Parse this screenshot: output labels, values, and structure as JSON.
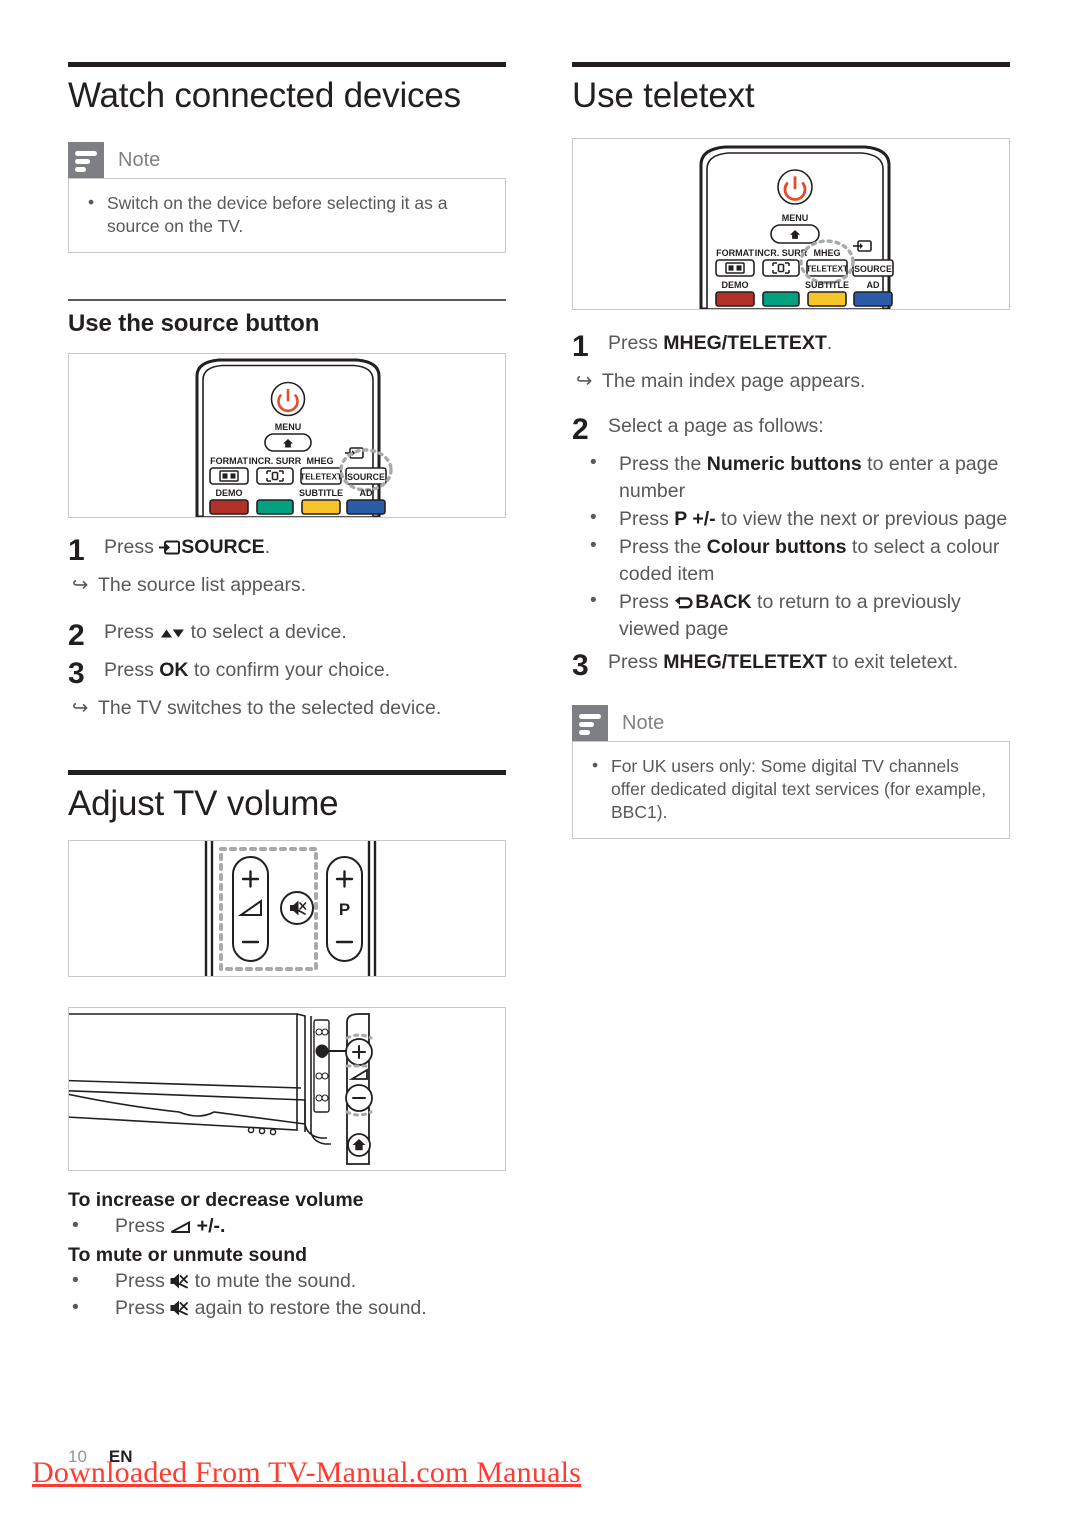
{
  "left_column": {
    "section_title": "Watch connected devices",
    "note": {
      "label": "Note",
      "items": [
        "Switch on the device before selecting it as a source on the TV."
      ]
    },
    "sub_title": "Use the source button",
    "figure_caption": "remote-control-top-source",
    "steps": [
      {
        "num": "1",
        "pre": "Press ",
        "icon": "source-icon",
        "bold": "SOURCE",
        "post": ".",
        "result": "The source list appears."
      },
      {
        "num": "2",
        "pre": "Press ",
        "icon": "updown-arrows",
        "bold": "",
        "post": " to select a device.",
        "result": ""
      },
      {
        "num": "3",
        "pre": "Press ",
        "icon": "",
        "bold": "OK",
        "post": " to confirm your choice.",
        "result": "The TV switches to the selected device."
      }
    ],
    "volume_section_title": "Adjust TV volume",
    "volume_block_1": {
      "title": "To increase or decrease volume",
      "items": [
        {
          "pre": "Press ",
          "icon": "volume-icon",
          "post": " +/-."
        }
      ]
    },
    "volume_block_2": {
      "title": "To mute or unmute sound",
      "items": [
        {
          "pre": "Press ",
          "icon": "mute-icon",
          "post": " to mute the sound."
        },
        {
          "pre": "Press ",
          "icon": "mute-icon",
          "post": " again to restore the sound."
        }
      ]
    }
  },
  "right_column": {
    "section_title": "Use teletext",
    "figure_caption": "remote-control-top-teletext",
    "step1": {
      "num": "1",
      "pre": "Press ",
      "bold": "MHEG/TELETEXT",
      "post": ".",
      "result": "The main index page appears."
    },
    "step2": {
      "num": "2",
      "text": "Select a page as follows:",
      "bullets": [
        {
          "pre": "Press the ",
          "bold": "Numeric buttons",
          "post": " to enter a page number",
          "icon": ""
        },
        {
          "pre": "Press ",
          "bold": "P +/-",
          "post": " to view the next or previous page",
          "icon": ""
        },
        {
          "pre": "Press the ",
          "bold": "Colour buttons",
          "post": " to select a colour coded item",
          "icon": ""
        },
        {
          "pre": "Press ",
          "bold": "BACK",
          "post": " to return to a previously viewed page",
          "icon": "back-icon"
        }
      ]
    },
    "step3": {
      "num": "3",
      "pre": "Press ",
      "bold": "MHEG/TELETEXT",
      "post": " to exit teletext."
    },
    "note": {
      "label": "Note",
      "items": [
        "For UK users only: Some digital TV channels offer dedicated digital text services (for example, BBC1)."
      ]
    }
  },
  "remote": {
    "menu_label": "MENU",
    "row_labels": [
      "FORMAT",
      "INCR. SURR",
      "MHEG",
      ""
    ],
    "teletext_button": "TELETEXT",
    "source_button": "SOURCE",
    "colour_labels": [
      "DEMO",
      "",
      "SUBTITLE",
      "AD"
    ],
    "colours": [
      "#b2322a",
      "#00a181",
      "#f5c52a",
      "#2a5caa"
    ],
    "power_colour": "#e8492b"
  },
  "footer": {
    "page_number": "10",
    "language": "EN",
    "watermark": "Downloaded From TV-Manual.com Manuals"
  }
}
